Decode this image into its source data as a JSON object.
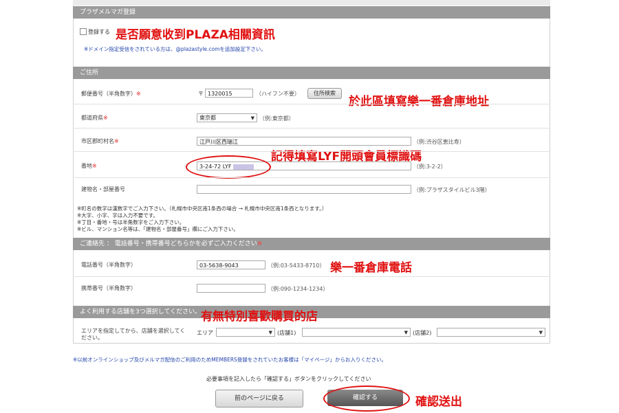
{
  "magazine": {
    "header": "プラザメルマガ登録",
    "checkbox_label": "登録する",
    "annotation": "是否願意收到PLAZA相關資訊",
    "note": "※ドメイン指定受信をされている方は、@plazastyle.comを追加設定下さい。"
  },
  "address": {
    "header": "ご住所",
    "postal": {
      "label": "郵便番号（半角数字）",
      "req": "※",
      "value": "1320015",
      "prefix": "〒",
      "hint": "（ハイフン不要）",
      "button": "住所検索"
    },
    "annotation_area": "於此區填寫樂一番倉庫地址",
    "prefecture": {
      "label": "都道府県",
      "req": "※",
      "value": "東京都",
      "hint": "（例:東京都）"
    },
    "city": {
      "label": "市区郡町村名",
      "req": "※",
      "value": "江戸川区西瑞江",
      "hint": "（例:渋谷区恵比寿）"
    },
    "annotation_code": "記得填寫LYF開頭會員標識碼",
    "street": {
      "label": "番地",
      "req": "※",
      "value": "3-24-72 LYF",
      "hint": "（例:3-2-2）"
    },
    "building": {
      "label": "建物名・部屋番号",
      "value": "",
      "hint": "（例:プラザスタイルビル3階）"
    },
    "notes": [
      "※町名の数字は漢数字でご入力下さい。（札幌市中央区南1条西の場合 → 札幌市中央区南1条西となります。）",
      "※大字、小字、字は入力不要です。",
      "※丁目・番地・号は半角数字をご入力下さい。",
      "※ビル、マンション名等は、「建物名・部屋番号」欄にご入力下さい。"
    ]
  },
  "contact": {
    "header": "ご連絡先 ： 電話番号・携帯番号どちらかを必ずご入力ください",
    "req": "※",
    "phone": {
      "label": "電話番号（半角数字）",
      "value": "03-5638-9043",
      "hint": "（例:03-5433-8710）"
    },
    "annotation_phone": "樂一番倉庫電話",
    "mobile": {
      "label": "携帯番号（半角数字）",
      "value": "",
      "hint": "（例:090-1234-1234）"
    }
  },
  "store": {
    "header": "よく利用する店舗を3つ選択してください。",
    "annotation": "有無特別喜歡購買的店",
    "label": "エリアを指定してから、店舗を選択してください。",
    "area_label": "エリア",
    "store1_label": "(店舗1)",
    "store2_label": "(店舗2)"
  },
  "footer": {
    "members_note": "※以前オンラインショップ及びメルマガ配信のご利用のためMEMBERS登録をされていたお客様は「マイページ」からお入りください。",
    "instruction": "必要事項を記入したら「確認する」ボタンをクリックしてください",
    "back_button": "前のページに戻る",
    "confirm_button": "確認する",
    "annotation_confirm": "確認送出"
  }
}
